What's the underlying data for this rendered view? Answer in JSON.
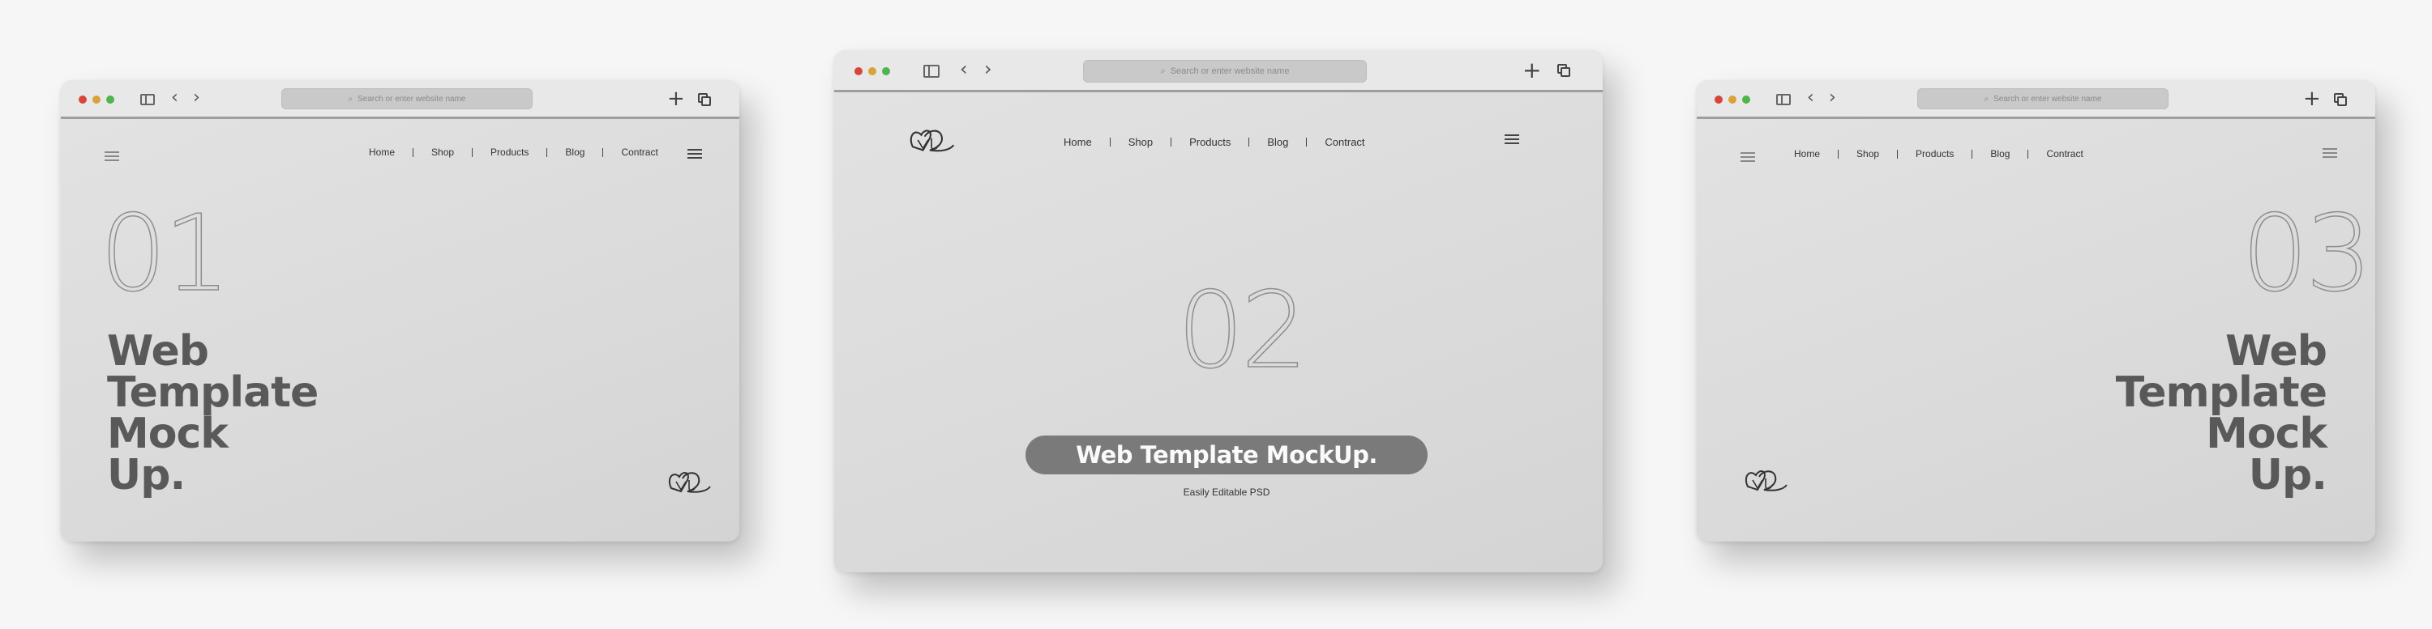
{
  "browser": {
    "url_placeholder": "Search or enter website name",
    "search_glyph": "⌕",
    "back_glyph": "‹",
    "forward_glyph": "›",
    "new_tab_glyph": "+"
  },
  "nav": {
    "items": [
      "Home",
      "Shop",
      "Products",
      "Blog",
      "Contract"
    ]
  },
  "panels": [
    {
      "number": "01",
      "heading": [
        "Web",
        "Template",
        "Mock",
        "Up."
      ]
    },
    {
      "number": "02",
      "pill": "Web Template MockUp.",
      "subtitle": "Easily Editable PSD"
    },
    {
      "number": "03",
      "heading": [
        "Web",
        "Template",
        "Mock",
        "Up."
      ]
    }
  ],
  "colors": {
    "background": "#f6f6f6",
    "browser_body": "#dcdcdc",
    "heading_text": "#595959",
    "pill_bg": "#7a7a7a",
    "dot_red": "#d8453b",
    "dot_yellow": "#d9a23a",
    "dot_green": "#4fb44a"
  }
}
